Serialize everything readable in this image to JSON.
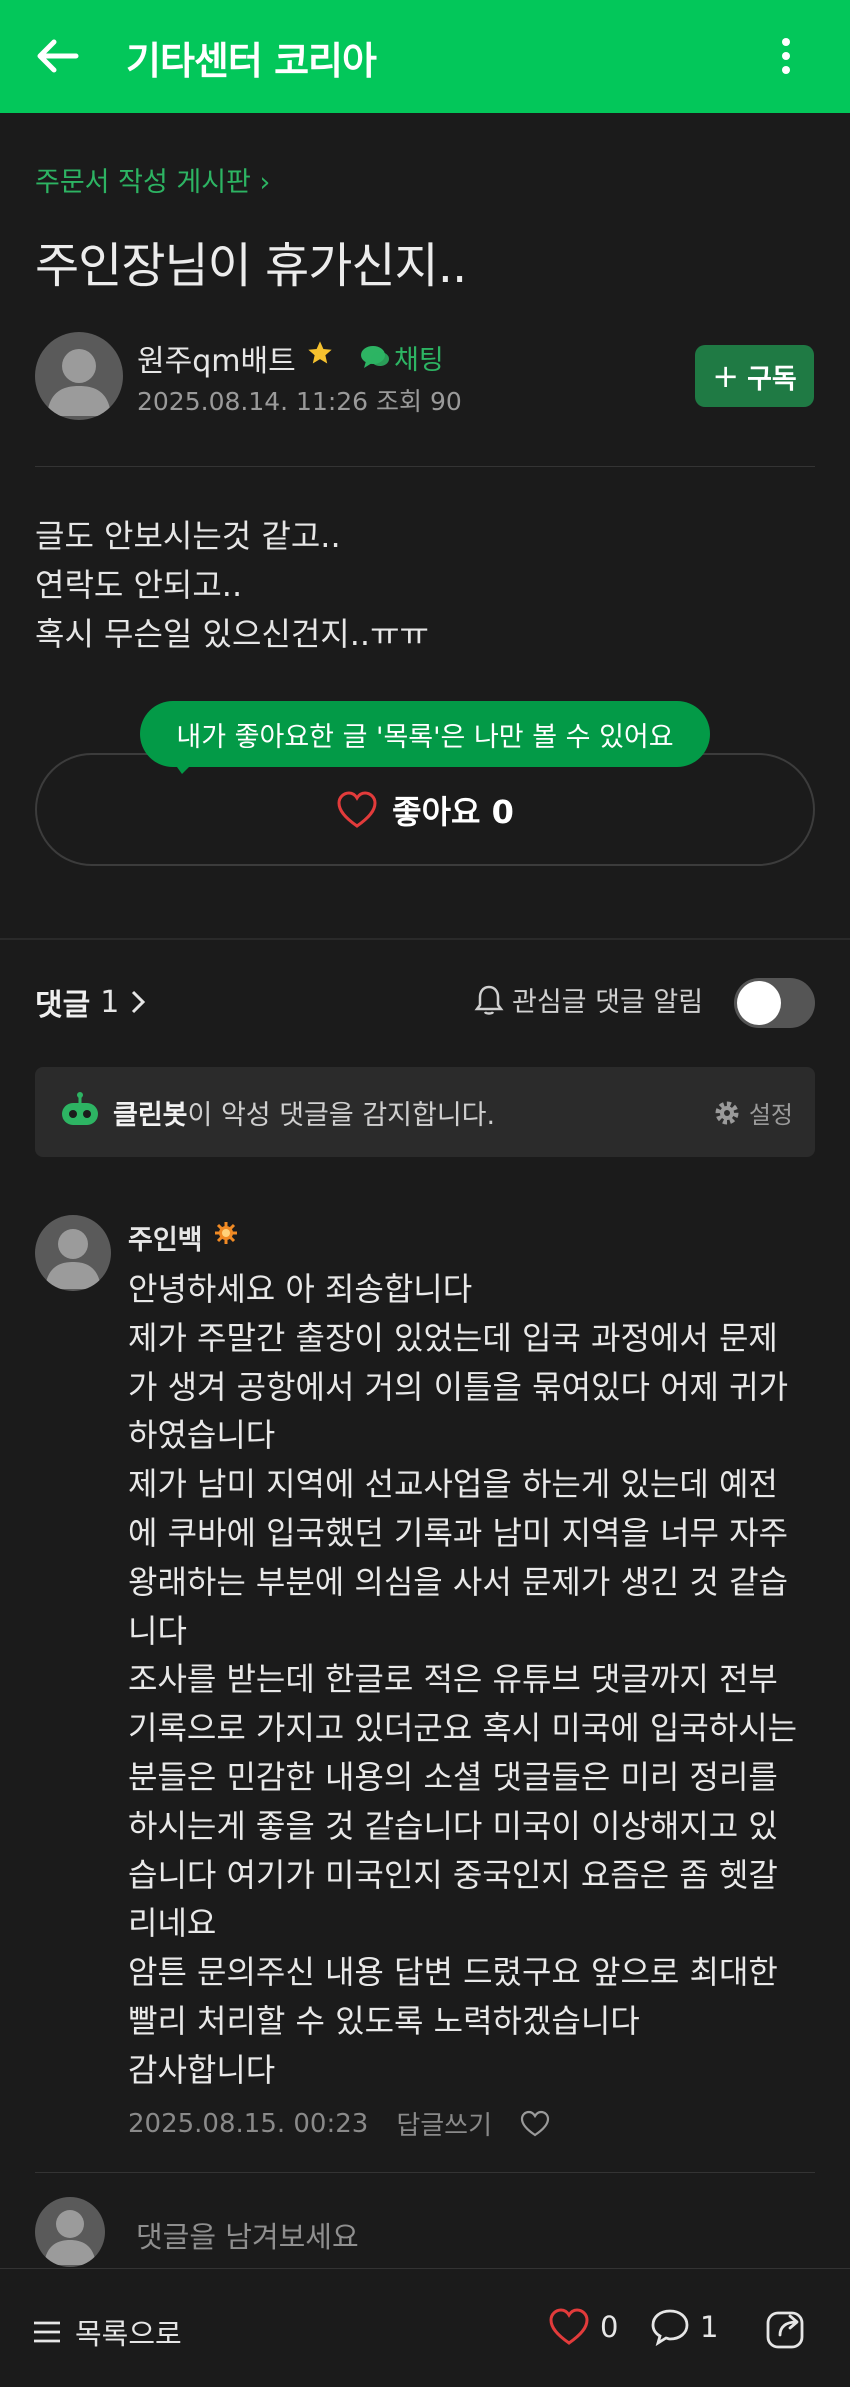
{
  "header": {
    "title": "기타센터 코리아"
  },
  "post": {
    "board": "주문서 작성 게시판",
    "title": "주인장님이 휴가신지..",
    "author": "원주qm배트",
    "chat_label": "채팅",
    "date": "2025.08.14. 11:26",
    "views": "조회 90",
    "subscribe_label": "구독",
    "body": [
      "글도 안보시는것 같고..",
      "연락도 안되고..",
      "혹시 무슨일 있으신건지..ㅠㅠ"
    ],
    "tooltip": "내가 좋아요한 글 '목록'은 나만 볼 수 있어요",
    "like_label": "좋아요 0"
  },
  "comments_section": {
    "label": "댓글",
    "count": "1",
    "notify_label": "관심글 댓글 알림",
    "notify_on": false,
    "cleanbot_name": "클린봇",
    "cleanbot_text": "이 악성 댓글을 감지합니다.",
    "settings_label": "설정"
  },
  "comment": {
    "author": "주인백",
    "lines": [
      "안녕하세요 아 죄송합니다",
      "제가 주말간 출장이 있었는데 입국 과정에서 문제",
      "가 생겨 공항에서 거의 이틀을 묶여있다 어제 귀가",
      "하였습니다",
      "제가 남미 지역에 선교사업을 하는게 있는데 예전",
      "에 쿠바에 입국했던 기록과 남미 지역을 너무 자주",
      "왕래하는 부분에 의심을 사서 문제가 생긴 것 같습",
      "니다",
      "조사를 받는데 한글로 적은 유튜브 댓글까지 전부",
      "기록으로 가지고 있더군요 혹시 미국에 입국하시는",
      "분들은 민감한 내용의 소셜 댓글들은 미리 정리를",
      "하시는게 좋을 것 같습니다 미국이 이상해지고 있",
      "습니다 여기가 미국인지 중국인지 요즘은 좀 헷갈",
      "리네요",
      "암튼 문의주신 내용 답변 드렸구요 앞으로 최대한",
      "빨리 처리할 수 있도록 노력하겠습니다",
      "감사합니다"
    ],
    "date": "2025.08.15. 00:23",
    "reply_label": "답글쓰기"
  },
  "write": {
    "placeholder": "댓글을 남겨보세요"
  },
  "bottom_bar": {
    "list_label": "목록으로",
    "likes": "0",
    "comments": "1"
  },
  "colors": {
    "brand": "#03c75a",
    "accent_text": "#2db463",
    "background": "#1b1b1b"
  }
}
